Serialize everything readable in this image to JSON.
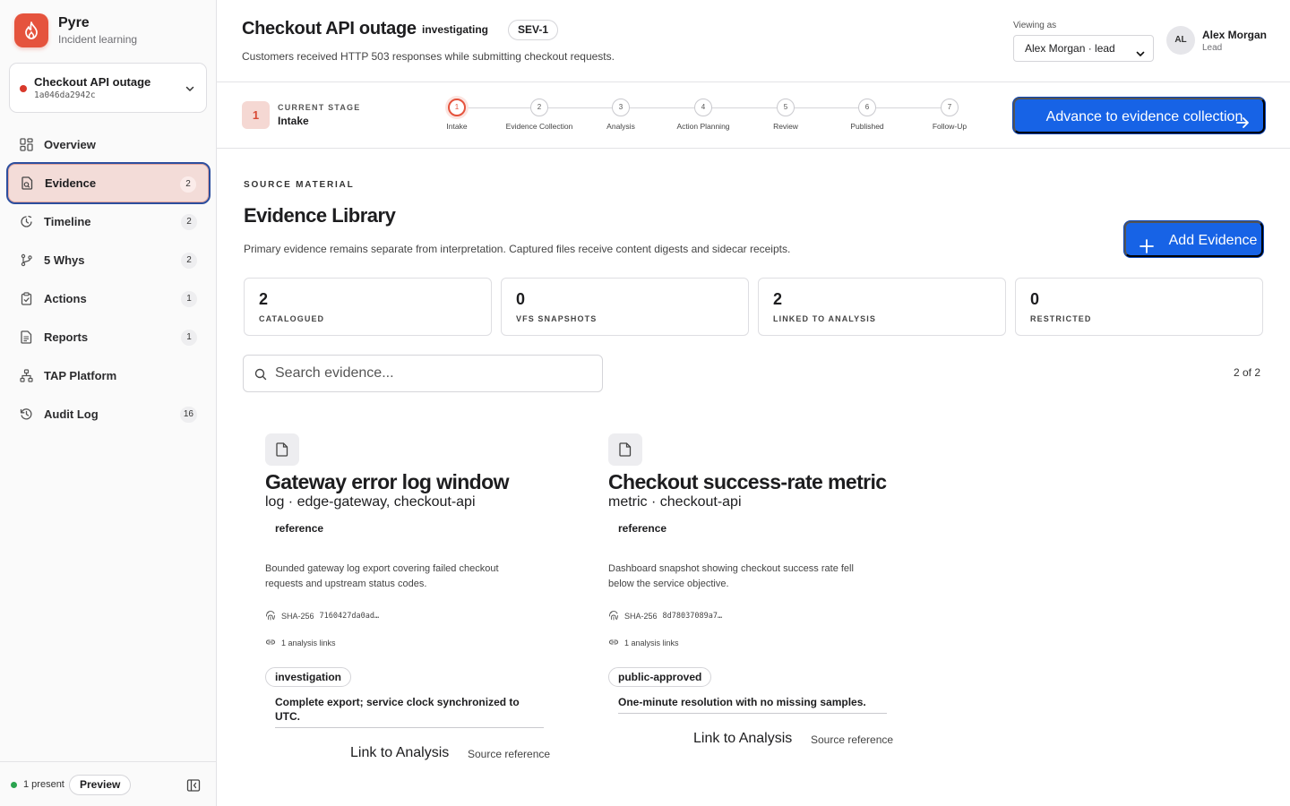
{
  "brand": {
    "name": "Pyre",
    "subtitle": "Incident learning",
    "logo_icon": "flame-icon",
    "accent": "#e5533d"
  },
  "incident_switcher": {
    "name": "Checkout API outage",
    "id": "1a046da2942c",
    "status_color": "#d8392b"
  },
  "nav": {
    "items": [
      {
        "label": "Overview",
        "icon": "grid-icon",
        "count": null,
        "active": false
      },
      {
        "label": "Evidence",
        "icon": "file-search-icon",
        "count": "2",
        "active": true
      },
      {
        "label": "Timeline",
        "icon": "clock-icon",
        "count": "2",
        "active": false
      },
      {
        "label": "5 Whys",
        "icon": "branch-icon",
        "count": "2",
        "active": false
      },
      {
        "label": "Actions",
        "icon": "clipboard-check-icon",
        "count": "1",
        "active": false
      },
      {
        "label": "Reports",
        "icon": "report-icon",
        "count": "1",
        "active": false
      },
      {
        "label": "TAP Platform",
        "icon": "network-icon",
        "count": null,
        "active": false
      },
      {
        "label": "Audit Log",
        "icon": "history-icon",
        "count": "16",
        "active": false
      }
    ]
  },
  "footer": {
    "presence": "1 present",
    "preview_label": "Preview",
    "presence_color": "#2aa44f"
  },
  "header": {
    "title": "Checkout API outage",
    "status": "investigating",
    "severity": "SEV-1",
    "description": "Customers received HTTP 503 responses while submitting checkout requests.",
    "viewing_as_label": "Viewing as",
    "viewing_as_value": "Alex Morgan · lead",
    "user": {
      "initials": "AL",
      "name": "Alex Morgan",
      "role": "Lead"
    }
  },
  "stage": {
    "number": "1",
    "caption": "CURRENT STAGE",
    "name": "Intake",
    "steps": [
      {
        "n": "1",
        "label": "Intake",
        "current": true
      },
      {
        "n": "2",
        "label": "Evidence Collection",
        "current": false
      },
      {
        "n": "3",
        "label": "Analysis",
        "current": false
      },
      {
        "n": "4",
        "label": "Action Planning",
        "current": false
      },
      {
        "n": "5",
        "label": "Review",
        "current": false
      },
      {
        "n": "6",
        "label": "Published",
        "current": false
      },
      {
        "n": "7",
        "label": "Follow-Up",
        "current": false
      }
    ],
    "advance_label": "Advance to evidence collection",
    "button_color": "#1763e6"
  },
  "library": {
    "eyebrow": "SOURCE MATERIAL",
    "title": "Evidence Library",
    "description": "Primary evidence remains separate from interpretation. Captured files receive content digests and sidecar receipts.",
    "add_label": "Add Evidence",
    "stats": [
      {
        "value": "2",
        "label": "CATALOGUED"
      },
      {
        "value": "0",
        "label": "VFS SNAPSHOTS"
      },
      {
        "value": "2",
        "label": "LINKED TO ANALYSIS"
      },
      {
        "value": "0",
        "label": "RESTRICTED"
      }
    ],
    "search_placeholder": "Search evidence...",
    "result_count": "2 of 2",
    "cards": [
      {
        "title": "Gateway error log window",
        "subtitle": "log · edge-gateway, checkout-api",
        "tag": "reference",
        "description": "Bounded gateway log export covering failed checkout requests and upstream status codes.",
        "hash_label": "SHA-256",
        "hash_value": "7160427da0ad…",
        "links": "1 analysis links",
        "classification": "investigation",
        "note": "Complete export; service clock synchronized to UTC.",
        "link_action": "Link to Analysis",
        "source_action": "Source reference"
      },
      {
        "title": "Checkout success-rate metric",
        "subtitle": "metric · checkout-api",
        "tag": "reference",
        "description": "Dashboard snapshot showing checkout success rate fell below the service objective.",
        "hash_label": "SHA-256",
        "hash_value": "8d78037089a7…",
        "links": "1 analysis links",
        "classification": "public-approved",
        "note": "One-minute resolution with no missing samples.",
        "link_action": "Link to Analysis",
        "source_action": "Source reference"
      }
    ]
  }
}
